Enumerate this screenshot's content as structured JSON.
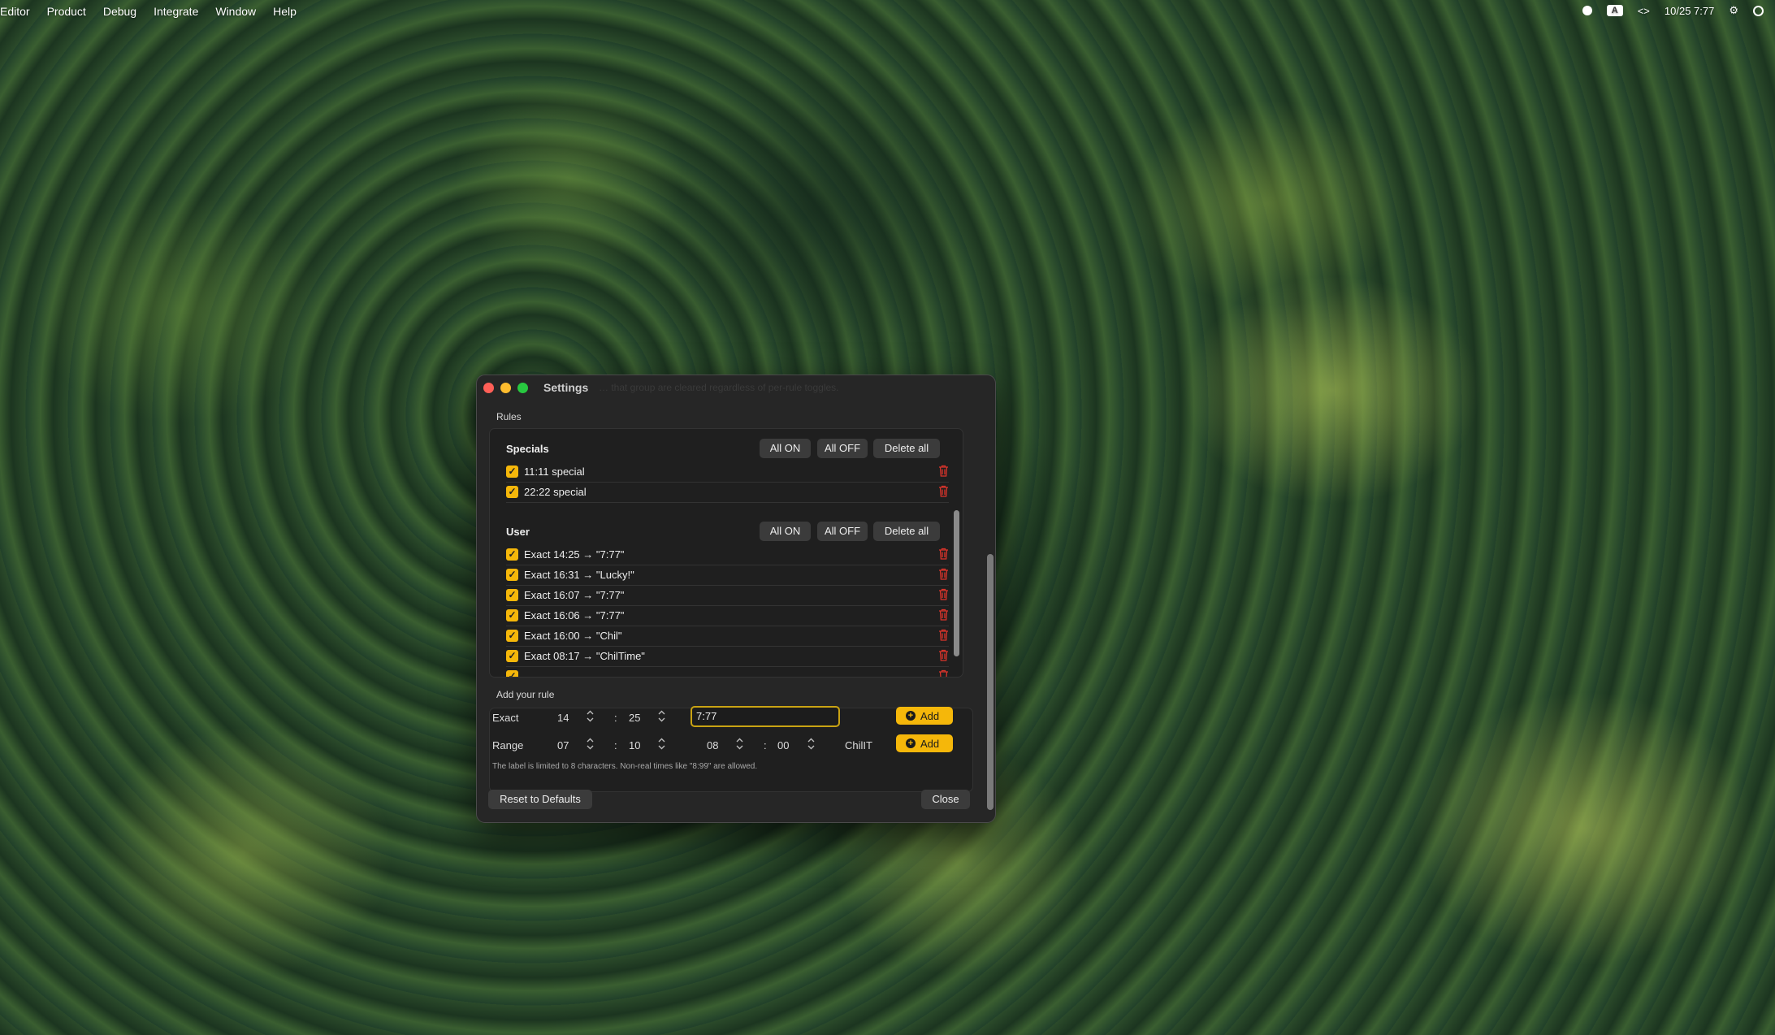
{
  "menubar": {
    "items": [
      "Editor",
      "Product",
      "Debug",
      "Integrate",
      "Window",
      "Help"
    ],
    "input_badge": "A",
    "clock": "10/25  7:77"
  },
  "window": {
    "title": "Settings",
    "ghost_text": "… that group are cleared regardless of per-rule toggles.",
    "rules_label": "Rules",
    "groups": [
      {
        "title": "Specials",
        "all_on": "All ON",
        "all_off": "All OFF",
        "delete_all": "Delete all",
        "items": [
          {
            "label": "11:11 special",
            "checked": true
          },
          {
            "label": "22:22 special",
            "checked": true
          }
        ]
      },
      {
        "title": "User",
        "all_on": "All ON",
        "all_off": "All OFF",
        "delete_all": "Delete all",
        "items": [
          {
            "label": "Exact 14:25 → \"7:77\"",
            "checked": true
          },
          {
            "label": "Exact 16:31 → \"Lucky!\"",
            "checked": true
          },
          {
            "label": "Exact 16:07 → \"7:77\"",
            "checked": true
          },
          {
            "label": "Exact 16:06 → \"7:77\"",
            "checked": true
          },
          {
            "label": "Exact 16:00 → \"Chil\"",
            "checked": true
          },
          {
            "label": "Exact 08:17 → \"ChilTime\"",
            "checked": true
          }
        ]
      }
    ],
    "add_rule": {
      "label": "Add your rule",
      "exact": {
        "label": "Exact",
        "hour": "14",
        "minute": "25",
        "text": "7:77",
        "add": "Add"
      },
      "range": {
        "label": "Range",
        "from_hour": "07",
        "from_minute": "10",
        "to_hour": "08",
        "to_minute": "00",
        "text": "ChilIT",
        "add": "Add"
      },
      "hint": "The label is limited to 8 characters. Non-real times like \"8:99\" are allowed."
    },
    "reset": "Reset to Defaults",
    "close": "Close"
  },
  "colors": {
    "accent": "#f5b70a",
    "delete": "#d9342b"
  }
}
